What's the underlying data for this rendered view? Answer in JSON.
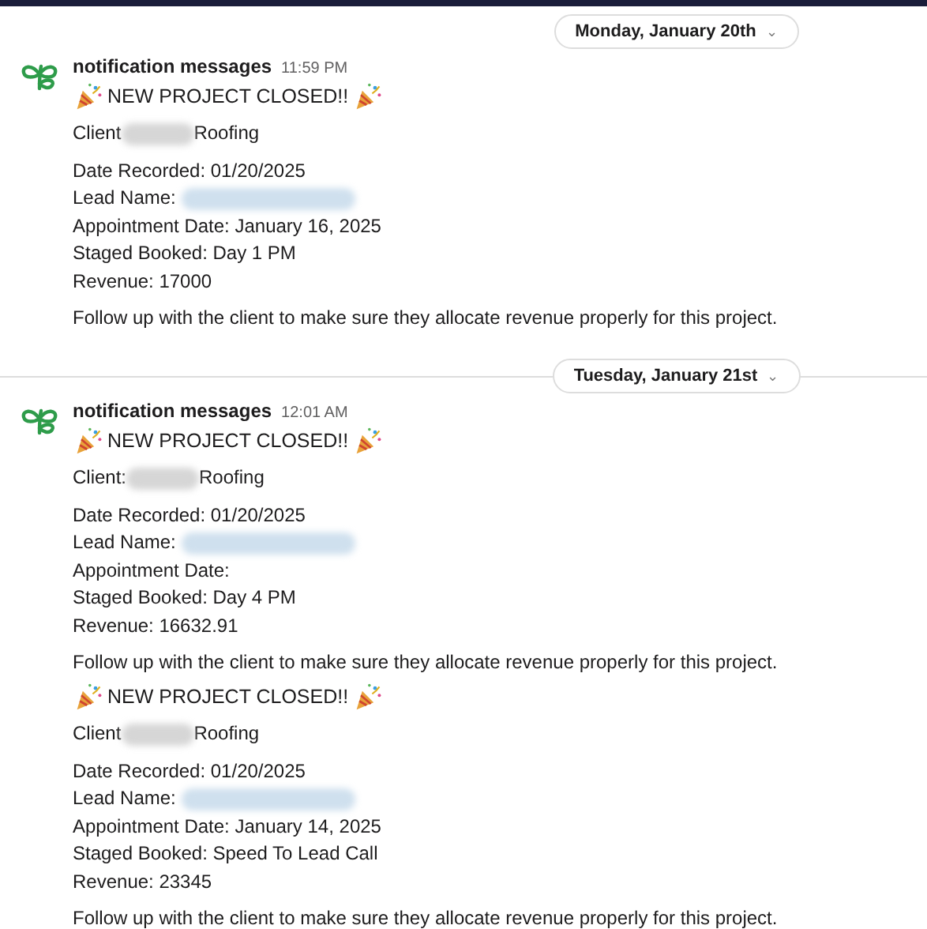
{
  "days": [
    {
      "date": "Monday, January 20th",
      "caret": "⌄",
      "messages": [
        {
          "sender": "notification messages",
          "time": "11:59 PM",
          "blocks": [
            {
              "title": "NEW PROJECT CLOSED!!",
              "client": [
                {
                  "text": "Client"
                },
                {
                  "kind": "redacted"
                },
                {
                  "text": "Roofing"
                }
              ],
              "fields": [
                [
                  {
                    "text": "Date Recorded: 01/20/2025"
                  }
                ],
                [
                  {
                    "text": "Lead Name:"
                  },
                  {
                    "kind": "redacted"
                  }
                ],
                [
                  {
                    "text": "Appointment Date: January 16, 2025"
                  }
                ],
                [
                  {
                    "text": "Staged Booked: Day 1 PM"
                  }
                ],
                [
                  {
                    "text": "Revenue: 17000"
                  }
                ]
              ],
              "note": "Follow up with the client to make sure they allocate revenue properly for this project."
            }
          ]
        }
      ]
    },
    {
      "date": "Tuesday, January 21st",
      "caret": "⌄",
      "messages": [
        {
          "sender": "notification messages",
          "time": "12:01 AM",
          "blocks": [
            {
              "title": "NEW PROJECT CLOSED!!",
              "client": [
                {
                  "text": "Client:"
                },
                {
                  "kind": "redacted"
                },
                {
                  "text": "Roofing"
                }
              ],
              "fields": [
                [
                  {
                    "text": "Date Recorded: 01/20/2025"
                  }
                ],
                [
                  {
                    "text": "Lead Name:"
                  },
                  {
                    "kind": "redacted"
                  }
                ],
                [
                  {
                    "text": "Appointment Date:"
                  }
                ],
                [
                  {
                    "text": "Staged Booked: Day 4 PM"
                  }
                ],
                [
                  {
                    "text": "Revenue: 16632.91"
                  }
                ]
              ],
              "note": "Follow up with the client to make sure they allocate revenue properly for this project."
            },
            {
              "title": "NEW PROJECT CLOSED!!",
              "client": [
                {
                  "text": "Client"
                },
                {
                  "kind": "redacted"
                },
                {
                  "text": "Roofing"
                }
              ],
              "fields": [
                [
                  {
                    "text": "Date Recorded: 01/20/2025"
                  }
                ],
                [
                  {
                    "text": "Lead Name:"
                  },
                  {
                    "kind": "redacted"
                  }
                ],
                [
                  {
                    "text": "Appointment Date: January 14, 2025"
                  }
                ],
                [
                  {
                    "text": "Staged Booked: Speed To Lead Call"
                  }
                ],
                [
                  {
                    "text": "Revenue: 23345"
                  }
                ]
              ],
              "note": "Follow up with the client to make sure they allocate revenue properly for this project."
            }
          ]
        }
      ]
    }
  ]
}
